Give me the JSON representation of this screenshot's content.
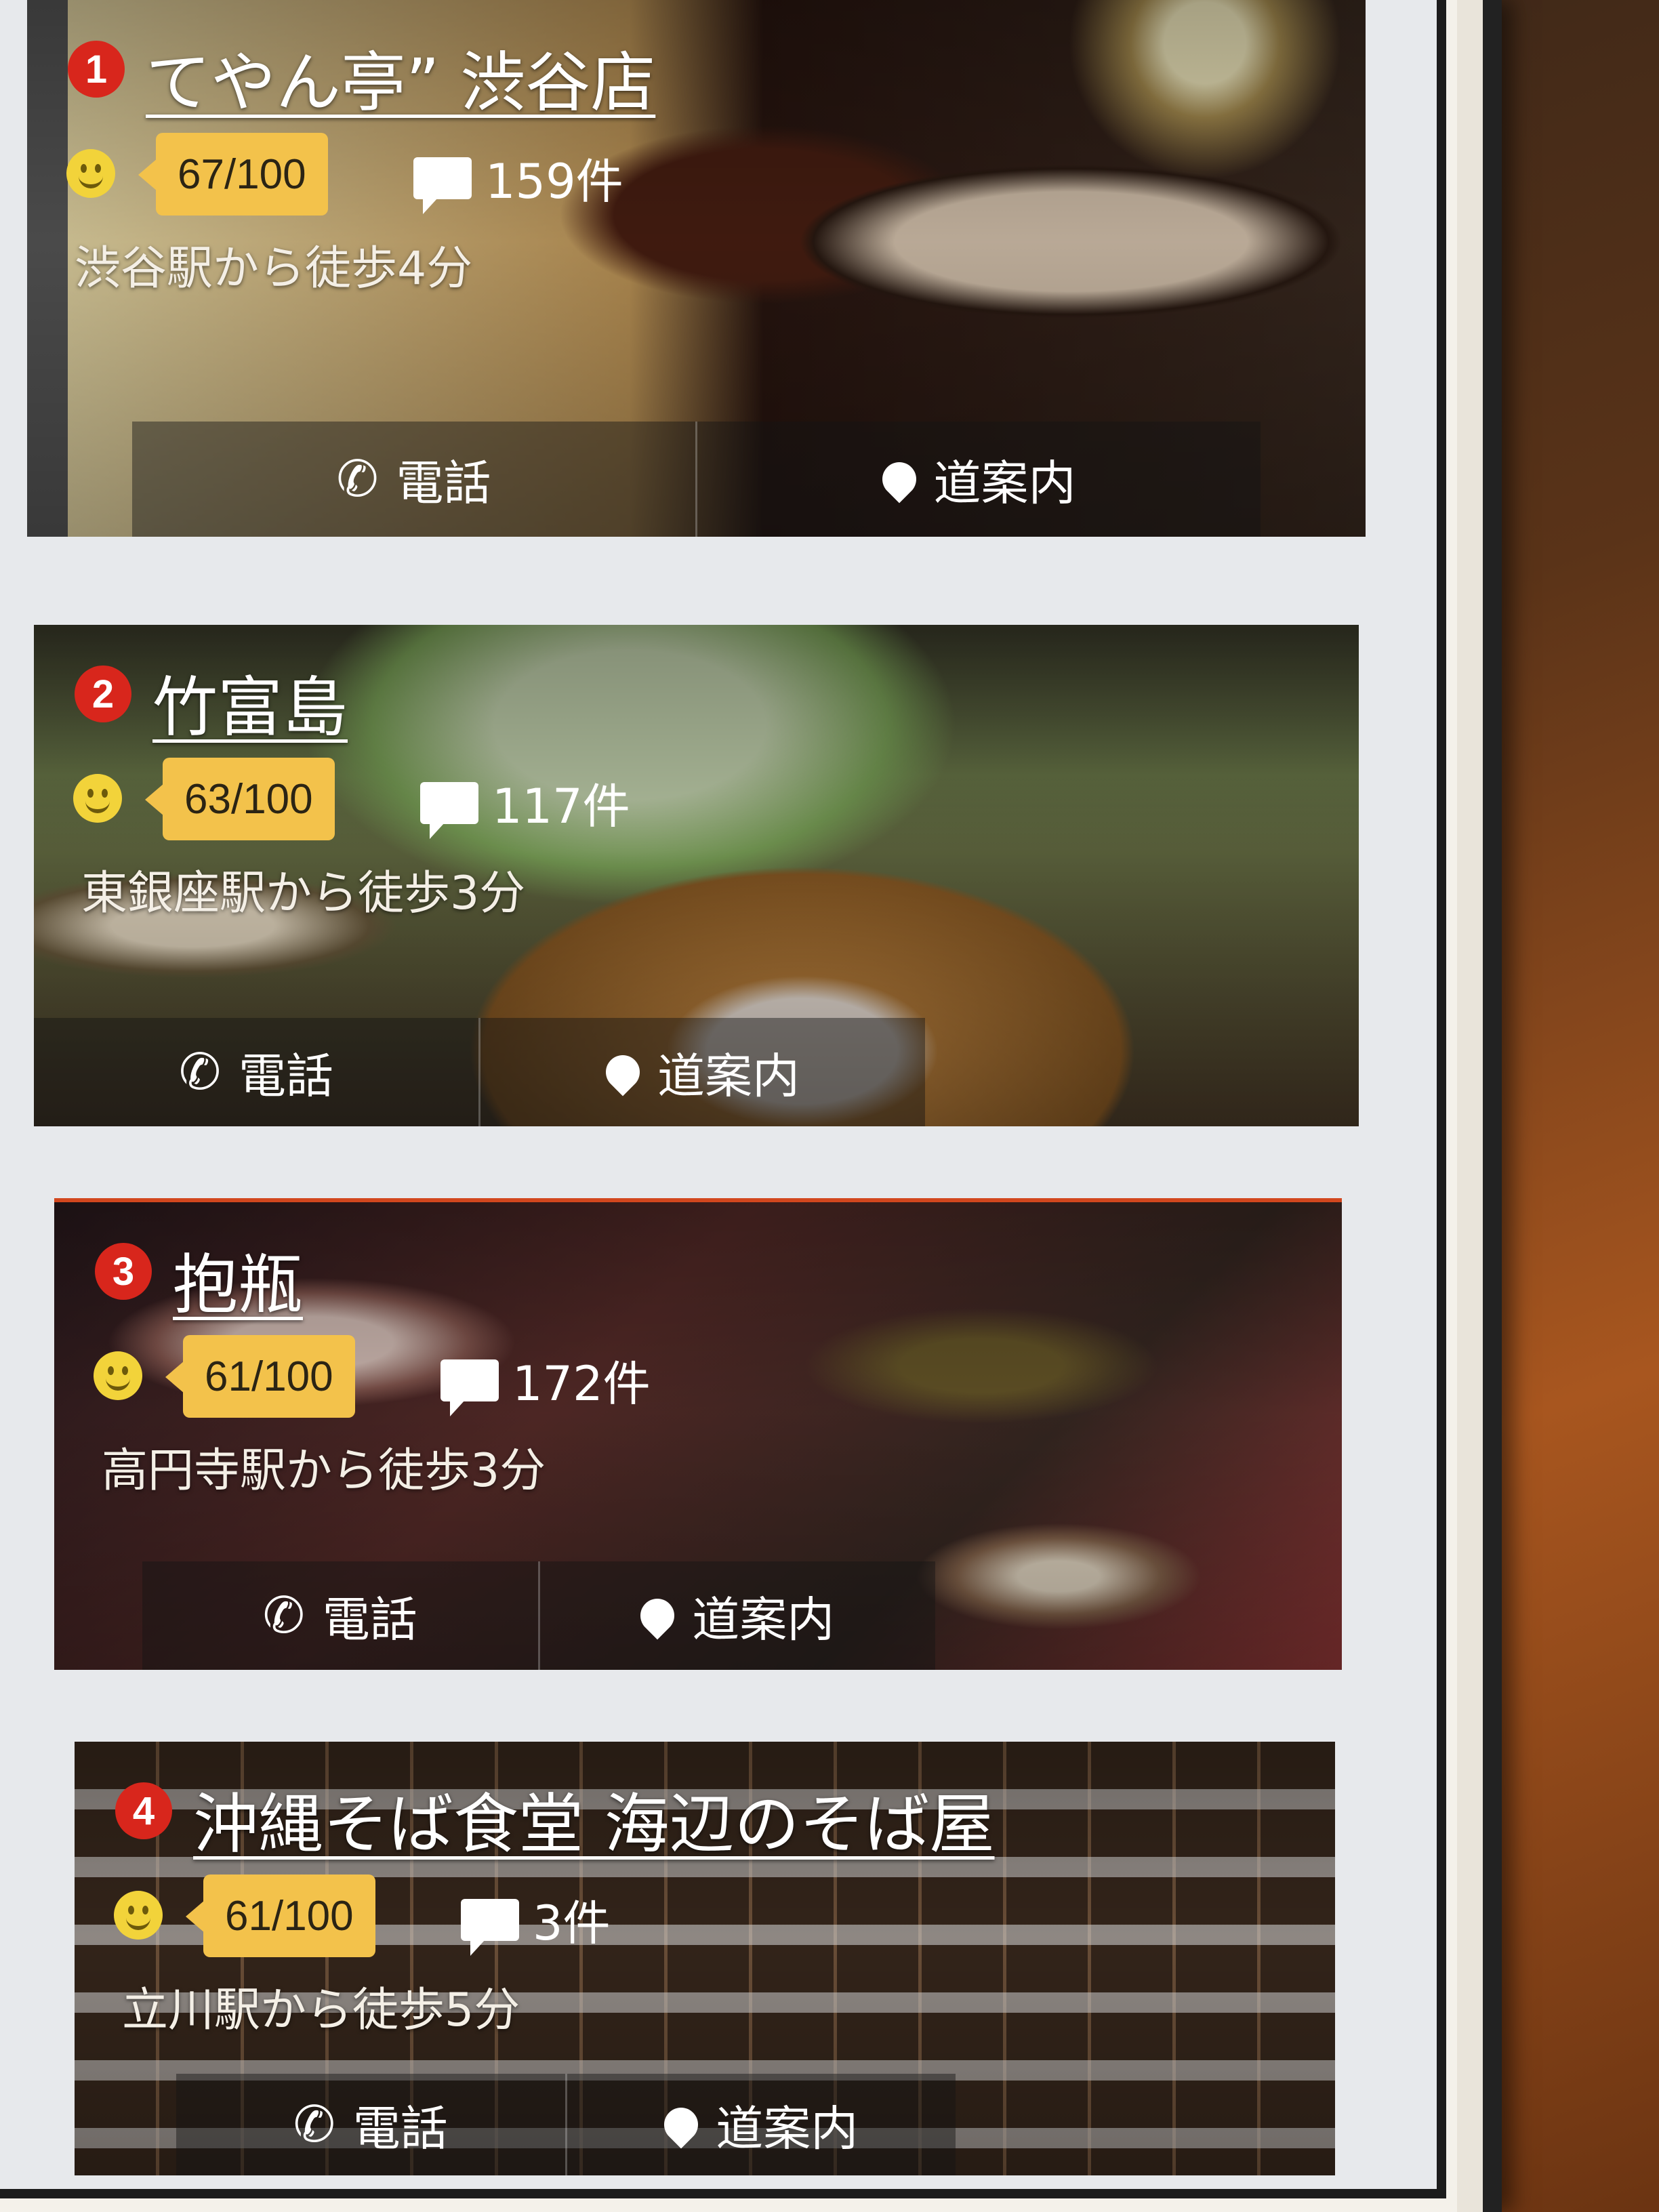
{
  "restaurants": [
    {
      "rank": "1",
      "name": "てやん亭” 渋谷店",
      "score": "67/100",
      "reviews": "159件",
      "access": "渋谷駅から徒歩4分",
      "call_label": "電話",
      "directions_label": "道案内"
    },
    {
      "rank": "2",
      "name": "竹富島",
      "score": "63/100",
      "reviews": "117件",
      "access": "東銀座駅から徒歩3分",
      "call_label": "電話",
      "directions_label": "道案内"
    },
    {
      "rank": "3",
      "name": "抱瓶",
      "score": "61/100",
      "reviews": "172件",
      "access": "高円寺駅から徒歩3分",
      "call_label": "電話",
      "directions_label": "道案内"
    },
    {
      "rank": "4",
      "name": "沖縄そば食堂 海辺のそば屋",
      "score": "61/100",
      "reviews": "3件",
      "access": "立川駅から徒歩5分",
      "call_label": "電話",
      "directions_label": "道案内"
    }
  ],
  "colors": {
    "rank_badge": "#d8261c",
    "score_tag": "#f3c24b",
    "smiley": "#f2d33a"
  },
  "icons": {
    "rating": "smiley-icon",
    "reviews": "speech-bubble-icon",
    "call": "phone-icon",
    "directions": "map-pin-icon"
  }
}
